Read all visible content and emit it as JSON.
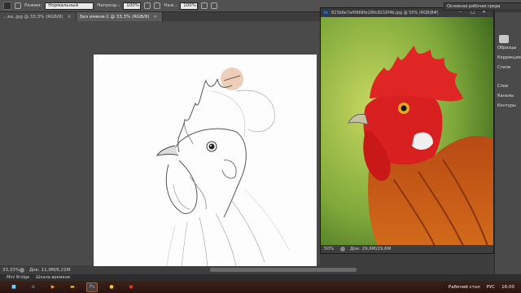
{
  "options_bar": {
    "mode_label": "Режим:",
    "mode_value": "Нормальный",
    "opacity_label": "Непрозр.:",
    "opacity_value": "100%",
    "pressure_label": "Наж.:",
    "pressure_value": "100%"
  },
  "tabs": [
    {
      "label": "...ва..jpg @ 33,3% (RGB/8)",
      "active": false
    },
    {
      "label": "Без имени-1 @ 33,3% (RGB/8)",
      "active": true
    }
  ],
  "document_status": {
    "zoom": "33,33%",
    "doc_size": "Док: 11,9M/6,21M"
  },
  "photo_window": {
    "title": "823b6e7af0968fe180c8216f4b.jpg @ 50% (RGB/8#)",
    "zoom": "50%",
    "doc_size": "Док: 29,6M/29,6M"
  },
  "right_panel": {
    "workspace": "Основная рабочая среда",
    "items": [
      "Образцы",
      "Коррекция",
      "Стили",
      "Слои",
      "Каналы",
      "Контуры"
    ]
  },
  "minibridge": {
    "tab1": "Mini Bridge",
    "tab2": "Шкала времени"
  },
  "taskbar": {
    "desktop_label": "Рабочий стол",
    "lang": "РУС",
    "time": "16:00",
    "apps": [
      "start",
      "ie",
      "media",
      "explorer",
      "photoshop",
      "chrome",
      "record"
    ]
  }
}
